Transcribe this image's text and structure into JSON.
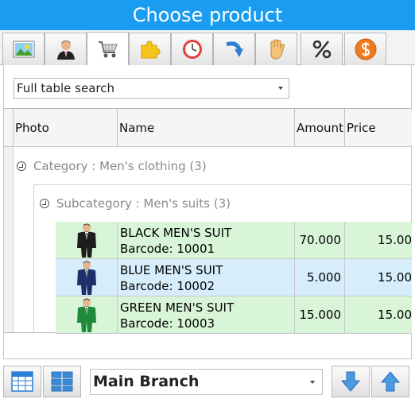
{
  "window": {
    "title": "Choose product"
  },
  "tabs": [
    {
      "icon": "landscape-picture-icon"
    },
    {
      "icon": "person-icon"
    },
    {
      "icon": "shopping-cart-icon",
      "active": true
    },
    {
      "icon": "puzzle-piece-icon"
    },
    {
      "icon": "clock-icon"
    },
    {
      "icon": "curved-arrow-icon"
    },
    {
      "icon": "raised-hand-icon"
    },
    {
      "icon": "percent-icon"
    },
    {
      "icon": "dollar-coin-icon"
    }
  ],
  "search": {
    "value": "Full table search"
  },
  "table": {
    "columns": [
      "Photo",
      "Name",
      "Amount",
      "Price"
    ],
    "category_label": "Category : Men's clothing (3)",
    "subcategory_label": "Subcategory : Men's suits (3)",
    "rows": [
      {
        "name": "BLACK MEN'S SUIT",
        "barcode": "Barcode: 10001",
        "amount": "70.000",
        "price": "15.00",
        "bg": "#d8f5d8",
        "suit_color": "#1d1d1d"
      },
      {
        "name": "BLUE MEN'S SUIT",
        "barcode": "Barcode: 10002",
        "amount": "5.000",
        "price": "15.00",
        "bg": "#d6eefb",
        "suit_color": "#1e2f6b"
      },
      {
        "name": "GREEN MEN'S SUIT",
        "barcode": "Barcode: 10003",
        "amount": "15.000",
        "price": "15.00",
        "bg": "#d8f5d8",
        "suit_color": "#1f8b3a"
      }
    ]
  },
  "bottom": {
    "branch": "Main Branch"
  },
  "colors": {
    "accent": "#1a9cf0"
  }
}
